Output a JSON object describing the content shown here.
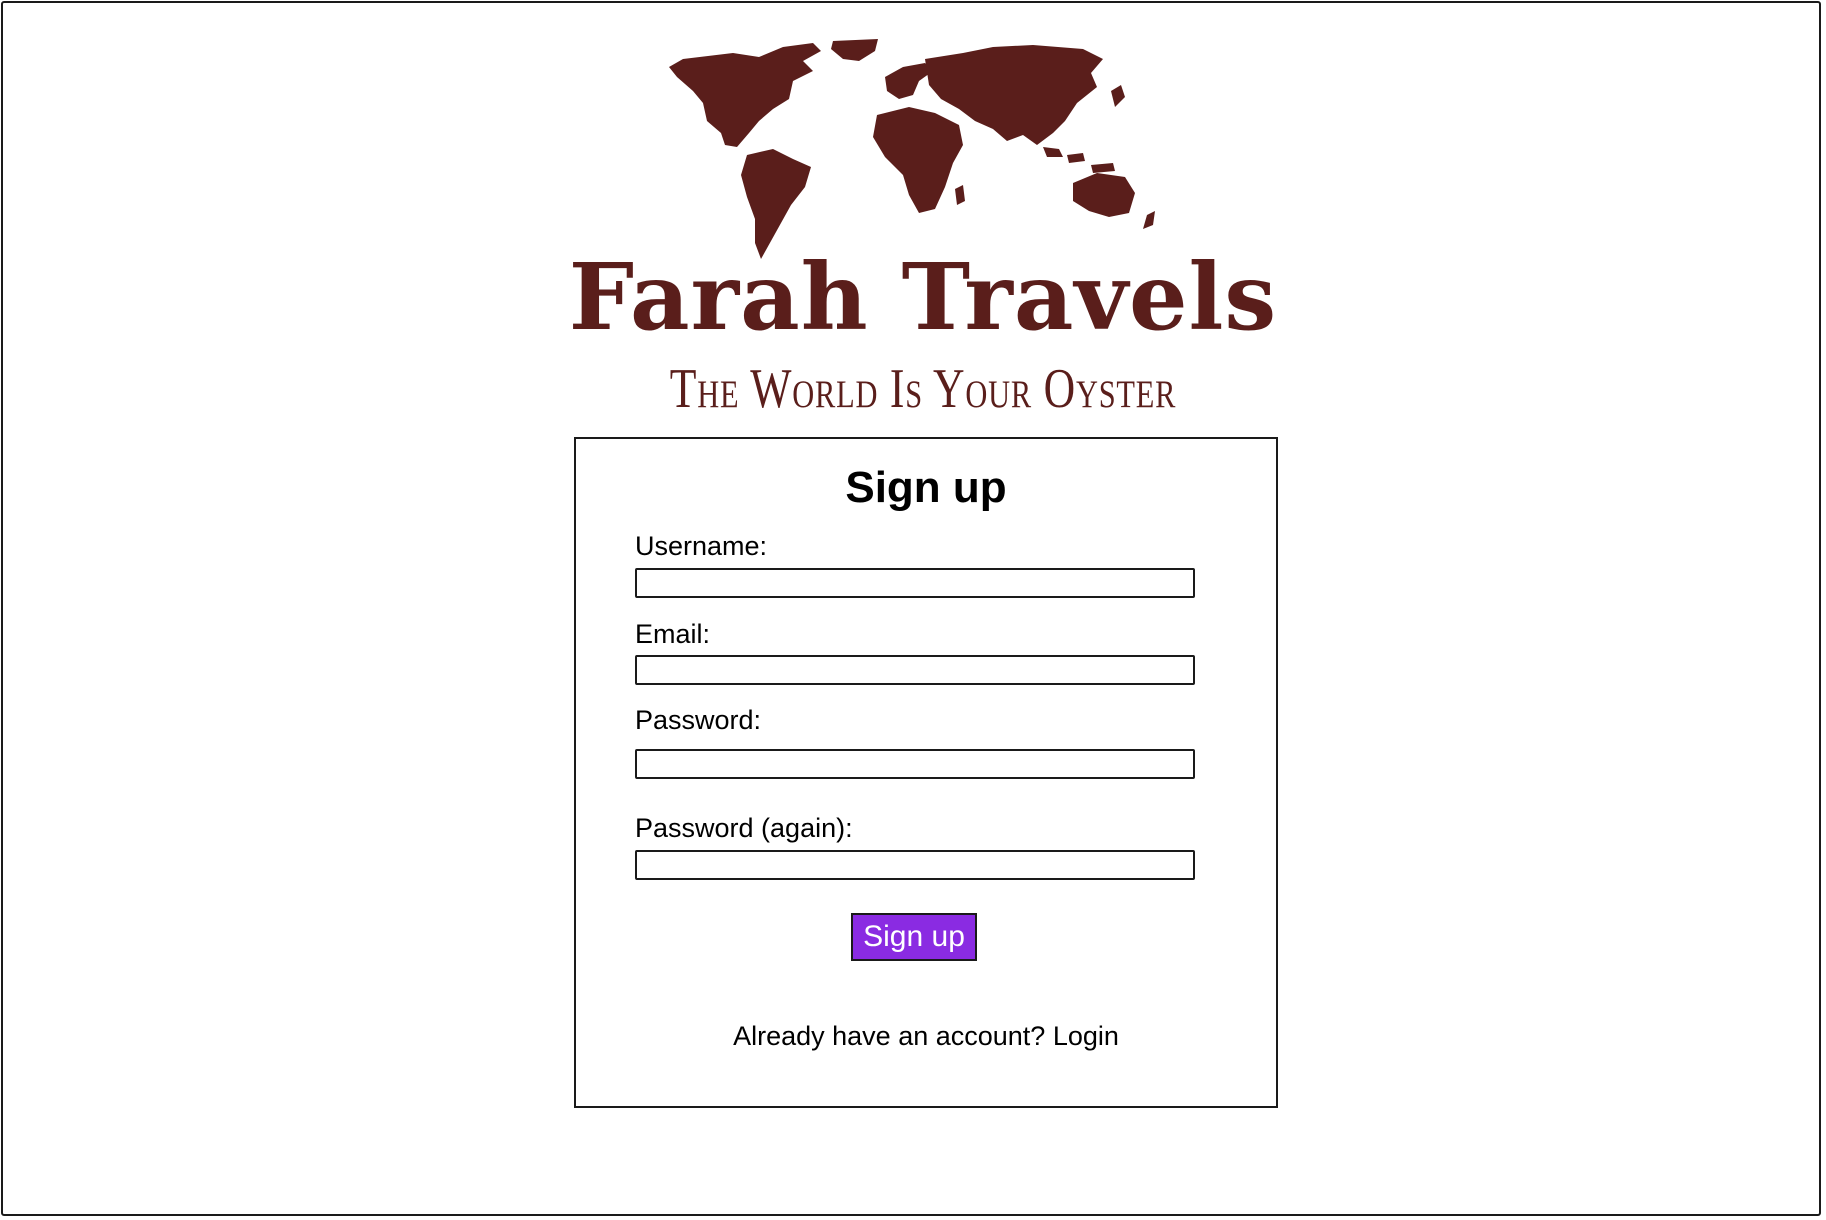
{
  "brand": {
    "name": "Farah Travels",
    "tagline": "The World Is Your Oyster",
    "logo_icon": "world-map-icon",
    "color": "#5a1e1b"
  },
  "form": {
    "title": "Sign up",
    "fields": [
      {
        "label": "Username:",
        "value": "",
        "placeholder": ""
      },
      {
        "label": "Email:",
        "value": "",
        "placeholder": ""
      },
      {
        "label": "Password:",
        "value": "",
        "placeholder": ""
      },
      {
        "label": "Password (again):",
        "value": "",
        "placeholder": ""
      }
    ],
    "submit_label": "Sign up",
    "submit_color": "#8a2be2",
    "login_prompt": "Already have an account?",
    "login_link": "Login"
  }
}
